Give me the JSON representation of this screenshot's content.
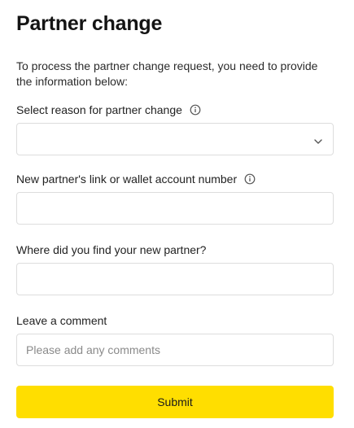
{
  "header": {
    "title": "Partner change"
  },
  "intro": {
    "text": "To process the partner change request, you need to provide the information below:"
  },
  "form": {
    "reason": {
      "label": "Select reason for partner change",
      "value": "",
      "icon": "info-icon",
      "dropdown_icon": "chevron-down-icon"
    },
    "partner_link": {
      "label": "New partner's link or wallet account number",
      "value": "",
      "placeholder": "",
      "icon": "info-icon"
    },
    "source": {
      "label": "Where did you find your new partner?",
      "value": "",
      "placeholder": ""
    },
    "comment": {
      "label": "Leave a comment",
      "value": "",
      "placeholder": "Please add any comments"
    },
    "submit_label": "Submit"
  },
  "colors": {
    "accent": "#ffde00",
    "border": "#dddddd",
    "text": "#1a1a1a",
    "placeholder": "#8a8a8a"
  }
}
